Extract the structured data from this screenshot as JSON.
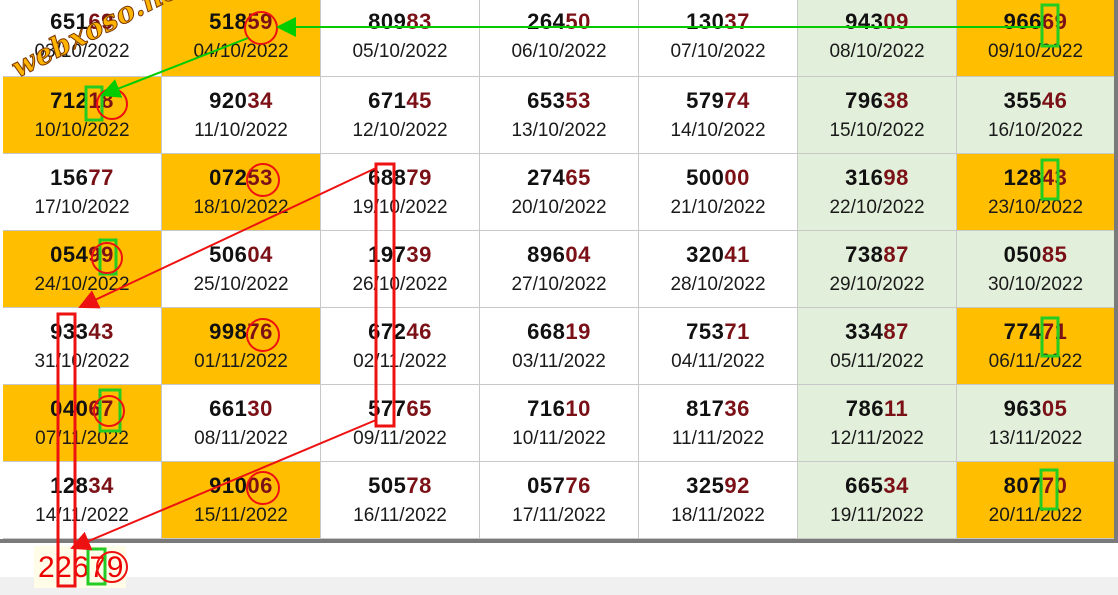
{
  "watermark": "webxoso.net",
  "result": "22679",
  "colors": {
    "highlight": "#ffbf00",
    "green_column": "#e2efda",
    "digit_dark": "#111111",
    "digit_red": "#7b1116",
    "arrow_green": "#00cc00",
    "arrow_red": "#ee1111"
  },
  "rows": [
    [
      {
        "pre": "651",
        "suf": "69",
        "date": "03/10/2022",
        "bg": "white"
      },
      {
        "pre": "518",
        "suf": "59",
        "date": "04/10/2022",
        "bg": "yellow"
      },
      {
        "pre": "809",
        "suf": "83",
        "date": "05/10/2022",
        "bg": "white"
      },
      {
        "pre": "264",
        "suf": "50",
        "date": "06/10/2022",
        "bg": "white"
      },
      {
        "pre": "130",
        "suf": "37",
        "date": "07/10/2022",
        "bg": "white"
      },
      {
        "pre": "943",
        "suf": "09",
        "date": "08/10/2022",
        "bg": "green"
      },
      {
        "pre": "966",
        "suf": "69",
        "date": "09/10/2022",
        "bg": "yellow"
      }
    ],
    [
      {
        "pre": "712",
        "suf": "18",
        "date": "10/10/2022",
        "bg": "yellow"
      },
      {
        "pre": "920",
        "suf": "34",
        "date": "11/10/2022",
        "bg": "white"
      },
      {
        "pre": "671",
        "suf": "45",
        "date": "12/10/2022",
        "bg": "white"
      },
      {
        "pre": "653",
        "suf": "53",
        "date": "13/10/2022",
        "bg": "white"
      },
      {
        "pre": "579",
        "suf": "74",
        "date": "14/10/2022",
        "bg": "white"
      },
      {
        "pre": "796",
        "suf": "38",
        "date": "15/10/2022",
        "bg": "green"
      },
      {
        "pre": "355",
        "suf": "46",
        "date": "16/10/2022",
        "bg": "green"
      }
    ],
    [
      {
        "pre": "156",
        "suf": "77",
        "date": "17/10/2022",
        "bg": "white"
      },
      {
        "pre": "072",
        "suf": "53",
        "date": "18/10/2022",
        "bg": "yellow"
      },
      {
        "pre": "688",
        "suf": "79",
        "date": "19/10/2022",
        "bg": "white"
      },
      {
        "pre": "274",
        "suf": "65",
        "date": "20/10/2022",
        "bg": "white"
      },
      {
        "pre": "500",
        "suf": "00",
        "date": "21/10/2022",
        "bg": "white"
      },
      {
        "pre": "316",
        "suf": "98",
        "date": "22/10/2022",
        "bg": "green"
      },
      {
        "pre": "128",
        "suf": "43",
        "date": "23/10/2022",
        "bg": "yellow"
      }
    ],
    [
      {
        "pre": "054",
        "suf": "99",
        "date": "24/10/2022",
        "bg": "yellow"
      },
      {
        "pre": "506",
        "suf": "04",
        "date": "25/10/2022",
        "bg": "white"
      },
      {
        "pre": "197",
        "suf": "39",
        "date": "26/10/2022",
        "bg": "white"
      },
      {
        "pre": "896",
        "suf": "04",
        "date": "27/10/2022",
        "bg": "white"
      },
      {
        "pre": "320",
        "suf": "41",
        "date": "28/10/2022",
        "bg": "white"
      },
      {
        "pre": "738",
        "suf": "87",
        "date": "29/10/2022",
        "bg": "green"
      },
      {
        "pre": "050",
        "suf": "85",
        "date": "30/10/2022",
        "bg": "green"
      }
    ],
    [
      {
        "pre": "933",
        "suf": "43",
        "date": "31/10/2022",
        "bg": "white"
      },
      {
        "pre": "998",
        "suf": "76",
        "date": "01/11/2022",
        "bg": "yellow"
      },
      {
        "pre": "672",
        "suf": "46",
        "date": "02/11/2022",
        "bg": "white"
      },
      {
        "pre": "668",
        "suf": "19",
        "date": "03/11/2022",
        "bg": "white"
      },
      {
        "pre": "753",
        "suf": "71",
        "date": "04/11/2022",
        "bg": "white"
      },
      {
        "pre": "334",
        "suf": "87",
        "date": "05/11/2022",
        "bg": "green"
      },
      {
        "pre": "774",
        "suf": "71",
        "date": "06/11/2022",
        "bg": "yellow"
      }
    ],
    [
      {
        "pre": "040",
        "suf": "67",
        "date": "07/11/2022",
        "bg": "yellow"
      },
      {
        "pre": "661",
        "suf": "30",
        "date": "08/11/2022",
        "bg": "white"
      },
      {
        "pre": "577",
        "suf": "65",
        "date": "09/11/2022",
        "bg": "white"
      },
      {
        "pre": "716",
        "suf": "10",
        "date": "10/11/2022",
        "bg": "white"
      },
      {
        "pre": "817",
        "suf": "36",
        "date": "11/11/2022",
        "bg": "white"
      },
      {
        "pre": "786",
        "suf": "11",
        "date": "12/11/2022",
        "bg": "green"
      },
      {
        "pre": "963",
        "suf": "05",
        "date": "13/11/2022",
        "bg": "green"
      }
    ],
    [
      {
        "pre": "128",
        "suf": "34",
        "date": "14/11/2022",
        "bg": "white"
      },
      {
        "pre": "910",
        "suf": "06",
        "date": "15/11/2022",
        "bg": "yellow"
      },
      {
        "pre": "505",
        "suf": "78",
        "date": "16/11/2022",
        "bg": "white"
      },
      {
        "pre": "057",
        "suf": "76",
        "date": "17/11/2022",
        "bg": "white"
      },
      {
        "pre": "325",
        "suf": "92",
        "date": "18/11/2022",
        "bg": "white"
      },
      {
        "pre": "665",
        "suf": "34",
        "date": "19/11/2022",
        "bg": "green"
      },
      {
        "pre": "807",
        "suf": "70",
        "date": "20/11/2022",
        "bg": "yellow"
      }
    ]
  ]
}
